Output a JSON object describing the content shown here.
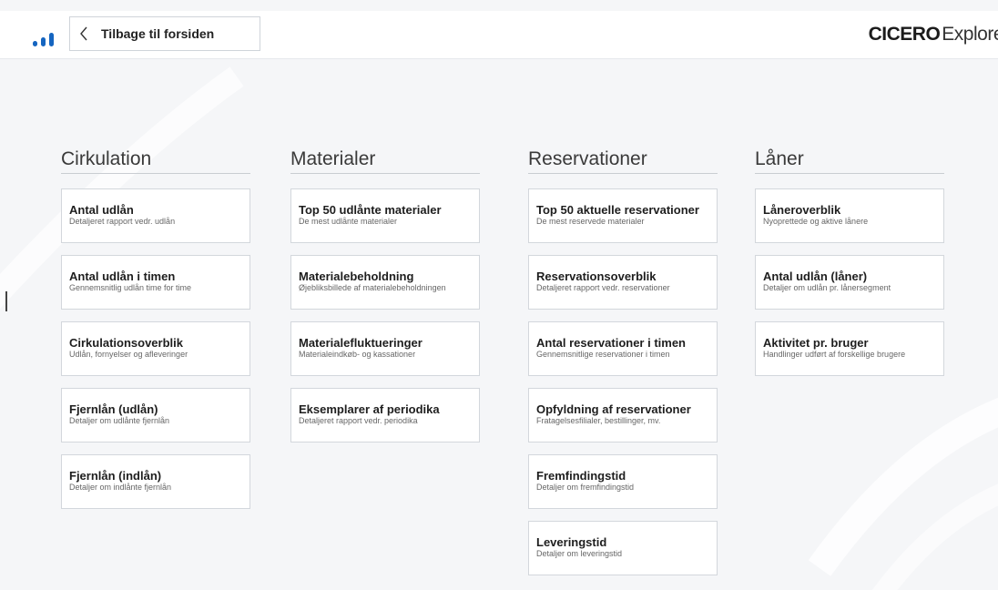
{
  "header": {
    "back_label": "Tilbage til forsiden",
    "brand_strong": "CICERO",
    "brand_light": "Explore",
    "logo_color": "#1565c0",
    "back_icon": "chevron-left-icon"
  },
  "columns": [
    {
      "title": "Cirkulation",
      "cards": [
        {
          "title": "Antal udlån",
          "sub": "Detaljeret rapport vedr. udlån"
        },
        {
          "title": "Antal udlån i timen",
          "sub": "Gennemsnitlig udlån time for time"
        },
        {
          "title": "Cirkulationsoverblik",
          "sub": "Udlån, fornyelser og afleveringer"
        },
        {
          "title": "Fjernlån (udlån)",
          "sub": "Detaljer om udlånte fjernlån"
        },
        {
          "title": "Fjernlån (indlån)",
          "sub": "Detaljer om indlånte fjernlån"
        }
      ]
    },
    {
      "title": "Materialer",
      "cards": [
        {
          "title": "Top 50 udlånte materialer",
          "sub": "De mest udlånte materialer"
        },
        {
          "title": "Materialebeholdning",
          "sub": "Øjebliksbillede af materialebeholdningen"
        },
        {
          "title": "Materialefluktueringer",
          "sub": "Materialeindkøb- og kassationer"
        },
        {
          "title": "Eksemplarer af periodika",
          "sub": "Detaljeret rapport vedr. periodika"
        }
      ]
    },
    {
      "title": "Reservationer",
      "cards": [
        {
          "title": "Top 50 aktuelle reservationer",
          "sub": "De mest reservede materialer"
        },
        {
          "title": "Reservationsoverblik",
          "sub": "Detaljeret rapport vedr. reservationer"
        },
        {
          "title": "Antal reservationer i timen",
          "sub": "Gennemsnitlige reservationer i timen"
        },
        {
          "title": "Opfyldning af reservationer",
          "sub": "Fratagelsesfilialer, bestillinger, mv."
        },
        {
          "title": "Fremfindingstid",
          "sub": "Detaljer om fremfindingstid"
        },
        {
          "title": "Leveringstid",
          "sub": "Detaljer om leveringstid"
        }
      ]
    },
    {
      "title": "Låner",
      "cards": [
        {
          "title": "Låneroverblik",
          "sub": "Nyoprettede og aktive lånere"
        },
        {
          "title": "Antal udlån (låner)",
          "sub": "Detaljer om udlån pr. lånersegment"
        },
        {
          "title": "Aktivitet pr. bruger",
          "sub": "Handlinger udført af forskellige brugere"
        }
      ]
    }
  ]
}
